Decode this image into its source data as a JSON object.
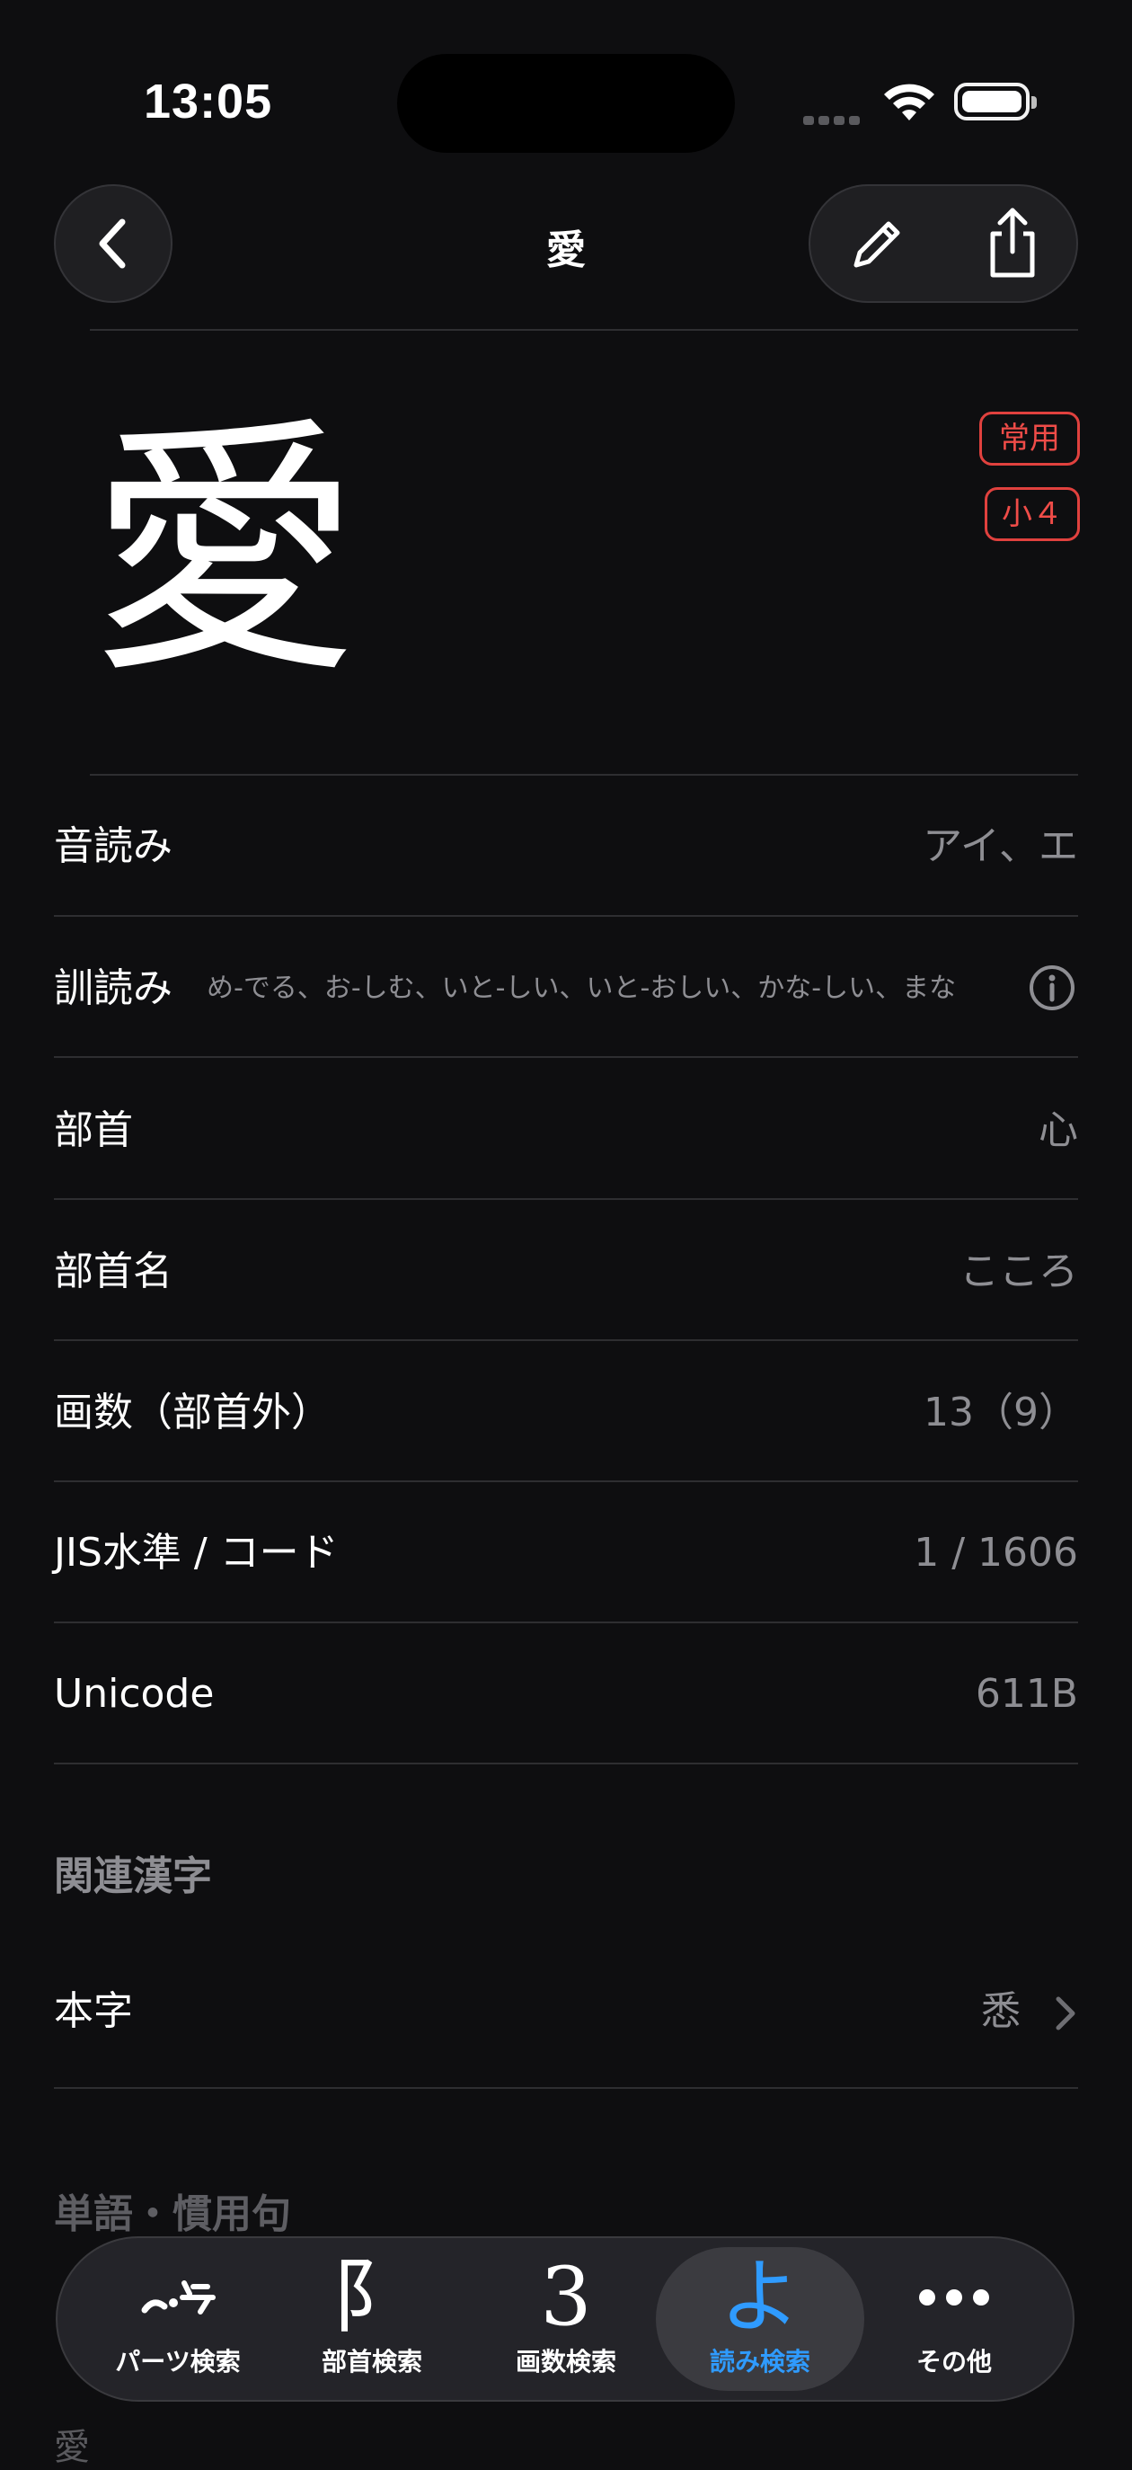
{
  "status_bar": {
    "time": "13:05"
  },
  "nav": {
    "title": "愛"
  },
  "hero": {
    "kanji": "愛",
    "badges": [
      "常用",
      "小４"
    ]
  },
  "rows": [
    {
      "label": "音読み",
      "value": "アイ、エ"
    },
    {
      "label": "訓読み",
      "value": "め-でる、お-しむ、いと-しい、いと-おしい、かな-しい、まな"
    },
    {
      "label": "部首",
      "value": "心"
    },
    {
      "label": "部首名",
      "value": "こころ"
    },
    {
      "label": "画数（部首外）",
      "value": "13（9）"
    },
    {
      "label": "JIS水準 / コード",
      "value": "1 / 1606"
    },
    {
      "label": "Unicode",
      "value": "611B"
    }
  ],
  "related": {
    "header": "関連漢字",
    "items": [
      {
        "label": "本字",
        "value": "悉"
      }
    ]
  },
  "words": {
    "header": "単語・慣用句",
    "first_word": "愛"
  },
  "tabbar": {
    "tabs": [
      {
        "label": "パーツ検索",
        "icon": "parts-icon",
        "active": false
      },
      {
        "label": "部首検索",
        "icon": "radical-icon",
        "glyph": "阝",
        "active": false
      },
      {
        "label": "画数検索",
        "icon": "stroke-count-icon",
        "glyph": "3",
        "active": false
      },
      {
        "label": "読み検索",
        "icon": "reading-icon",
        "glyph": "よ",
        "active": true
      },
      {
        "label": "その他",
        "icon": "more-icon",
        "active": false
      }
    ]
  },
  "colors": {
    "background": "#0e0e10",
    "badge_red": "#ef4c48",
    "active_blue": "#2f9bff",
    "secondary_text": "#8e8e93"
  }
}
